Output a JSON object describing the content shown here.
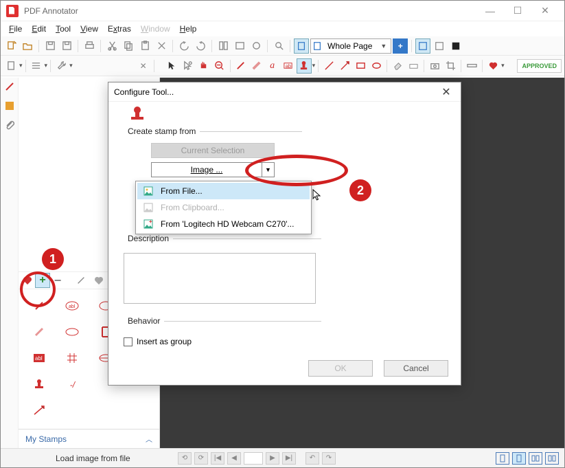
{
  "window": {
    "title": "PDF Annotator"
  },
  "menu": {
    "file": "File",
    "edit": "Edit",
    "tool": "Tool",
    "view": "View",
    "extras": "Extras",
    "window": "Window",
    "help": "Help"
  },
  "zoom": {
    "mode": "Whole Page"
  },
  "toolbar2": {
    "approved": "APPROVED"
  },
  "favorites": {
    "footer": "My Stamps"
  },
  "statusbar": {
    "text": "Load image from file"
  },
  "dialog": {
    "title": "Configure Tool...",
    "group_create": "Create stamp from",
    "current_selection": "Current Selection",
    "combo_label": "Image ...",
    "group_desc": "Description",
    "group_behavior": "Behavior",
    "insert_group": "Insert as group",
    "ok": "OK",
    "cancel": "Cancel"
  },
  "dropdown": {
    "from_file": "From File...",
    "from_clipboard": "From Clipboard...",
    "from_webcam": "From 'Logitech HD Webcam C270'..."
  },
  "callouts": {
    "one": "1",
    "two": "2"
  }
}
